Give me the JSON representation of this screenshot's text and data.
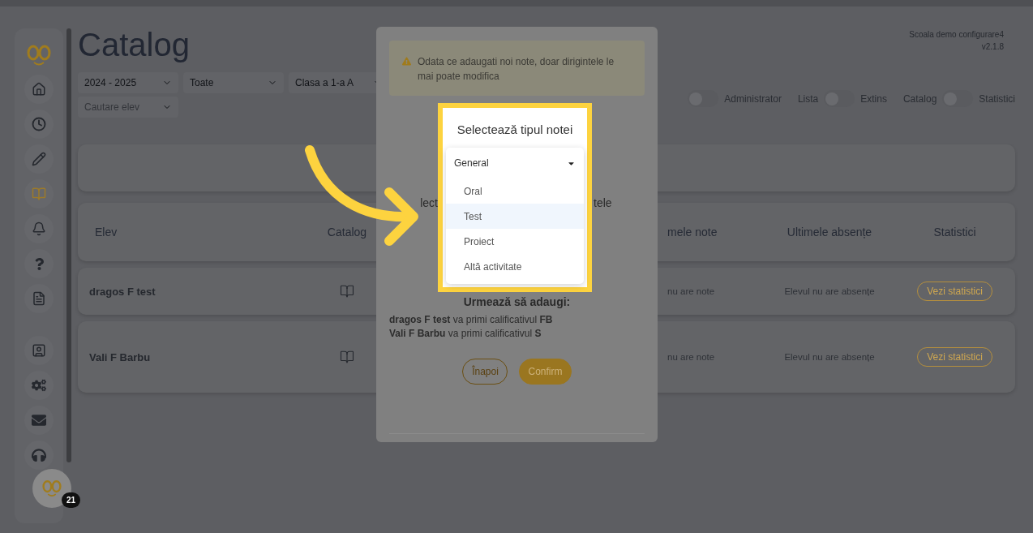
{
  "app": {
    "school": "Scoala demo configurare4",
    "version": "v2.1.8"
  },
  "sidebar": {
    "top_items": [
      {
        "kind": "home",
        "selected": false
      },
      {
        "kind": "clock",
        "selected": false
      },
      {
        "kind": "pencil",
        "selected": false
      },
      {
        "kind": "book",
        "selected": true
      },
      {
        "kind": "bell",
        "selected": false
      },
      {
        "kind": "question",
        "selected": false
      },
      {
        "kind": "document",
        "selected": false
      }
    ],
    "bottom_items": [
      {
        "kind": "contact",
        "selected": false
      },
      {
        "kind": "gears",
        "selected": false
      },
      {
        "kind": "mail",
        "selected": false
      },
      {
        "kind": "headphones",
        "selected": false
      }
    ]
  },
  "page": {
    "title": "Catalog"
  },
  "filters": [
    {
      "value": "2024 - 2025"
    },
    {
      "value": "Toate"
    },
    {
      "value": "Clasa a 1-a A"
    },
    {
      "placeholder": "Cautare elev"
    }
  ],
  "toggles": [
    {
      "right": "Administrator",
      "on": false
    },
    {
      "left": "Lista",
      "right": "Extins",
      "on": false
    },
    {
      "left": "Catalog",
      "right": "Statistici",
      "on": false
    }
  ],
  "table": {
    "columns": [
      "Elev",
      "Catalog",
      "mele note",
      "Ultimele absențe",
      "Statistici"
    ],
    "rows": [
      {
        "student": "dragos F test",
        "grades": "nu are note",
        "absences": "Elevul nu are absențe",
        "action": "Vezi statistici"
      },
      {
        "student": "Vali F Barbu",
        "grades": "nu are note",
        "absences": "Elevul nu are absențe",
        "action": "Vezi statistici"
      }
    ]
  },
  "modal": {
    "alert": "Odata ce adaugati noi note, doar dirigintele le mai poate modifica",
    "heading_fragments": [
      "lect",
      "tele"
    ],
    "subheading": "Urmează să adaugi:",
    "lines": [
      "**dragos F test** va primi calificativul **FB**",
      "**Vali F Barbu** va primi calificativul **S**"
    ],
    "buttons": [
      {
        "label": "Înapoi",
        "kind": "outline"
      },
      {
        "label": "Confirm",
        "kind": "primary"
      }
    ]
  },
  "highlight": {
    "title": "Selectează tipul notei",
    "dropdown": {
      "value": "General",
      "options": [
        {
          "label": "Oral",
          "selected": false
        },
        {
          "label": "Test",
          "selected": true
        },
        {
          "label": "Proiect",
          "selected": false
        },
        {
          "label": "Altă activitate",
          "selected": false
        }
      ]
    }
  },
  "chat": {
    "badge": "21"
  }
}
